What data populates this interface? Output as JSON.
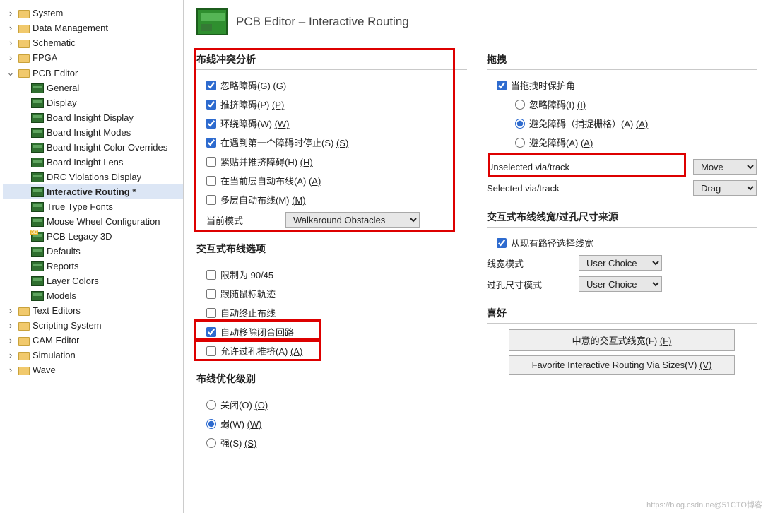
{
  "tree": [
    {
      "exp": ">",
      "i": "folder",
      "label": "System",
      "d": 0
    },
    {
      "exp": ">",
      "i": "folder",
      "label": "Data Management",
      "d": 0
    },
    {
      "exp": ">",
      "i": "folder",
      "label": "Schematic",
      "d": 0
    },
    {
      "exp": ">",
      "i": "folder",
      "label": "FPGA",
      "d": 0
    },
    {
      "exp": "v",
      "i": "folder",
      "label": "PCB Editor",
      "d": 0
    },
    {
      "exp": "",
      "i": "pcb",
      "label": "General",
      "d": 1
    },
    {
      "exp": "",
      "i": "pcb",
      "label": "Display",
      "d": 1
    },
    {
      "exp": "",
      "i": "pcb",
      "label": "Board Insight Display",
      "d": 1
    },
    {
      "exp": "",
      "i": "pcb",
      "label": "Board Insight Modes",
      "d": 1
    },
    {
      "exp": "",
      "i": "pcb",
      "label": "Board Insight Color Overrides",
      "d": 1
    },
    {
      "exp": "",
      "i": "pcb",
      "label": "Board Insight Lens",
      "d": 1
    },
    {
      "exp": "",
      "i": "pcb",
      "label": "DRC Violations Display",
      "d": 1
    },
    {
      "exp": "",
      "i": "pcb",
      "label": "Interactive Routing *",
      "d": 1,
      "sel": true
    },
    {
      "exp": "",
      "i": "pcb",
      "label": "True Type Fonts",
      "d": 1
    },
    {
      "exp": "",
      "i": "pcb",
      "label": "Mouse Wheel Configuration",
      "d": 1
    },
    {
      "exp": "",
      "i": "pcb3d",
      "label": "PCB Legacy 3D",
      "d": 1
    },
    {
      "exp": "",
      "i": "pcb",
      "label": "Defaults",
      "d": 1
    },
    {
      "exp": "",
      "i": "pcb",
      "label": "Reports",
      "d": 1
    },
    {
      "exp": "",
      "i": "pcb",
      "label": "Layer Colors",
      "d": 1
    },
    {
      "exp": "",
      "i": "pcb",
      "label": "Models",
      "d": 1
    },
    {
      "exp": ">",
      "i": "folder",
      "label": "Text Editors",
      "d": 0
    },
    {
      "exp": ">",
      "i": "folder",
      "label": "Scripting System",
      "d": 0
    },
    {
      "exp": ">",
      "i": "folder",
      "label": "CAM Editor",
      "d": 0
    },
    {
      "exp": ">",
      "i": "folder",
      "label": "Simulation",
      "d": 0
    },
    {
      "exp": ">",
      "i": "folder",
      "label": "Wave",
      "d": 0
    }
  ],
  "page_title": "PCB Editor – Interactive Routing",
  "sections": {
    "conflict": "布线冲突分析",
    "interactive": "交互式布线选项",
    "optimize": "布线优化级别",
    "drag": "拖拽",
    "width_src": "交互式布线线宽/过孔尺寸来源",
    "fav": "喜好"
  },
  "conflict": {
    "ignore": {
      "label": "忽略障碍(G)",
      "hot": "(G)",
      "checked": true
    },
    "push": {
      "label": "推挤障碍(P)",
      "hot": "(P)",
      "checked": true
    },
    "around": {
      "label": "环绕障碍(W)",
      "hot": "(W)",
      "checked": true
    },
    "stopfirst": {
      "label": "在遇到第一个障碍时停止(S)",
      "hot": "(S)",
      "checked": true
    },
    "hug": {
      "label": "紧贴并推挤障碍(H)",
      "hot": "(H)",
      "checked": false
    },
    "autocurrent": {
      "label": "在当前层自动布线(A)",
      "hot": "(A)",
      "checked": false
    },
    "multilayer": {
      "label": "多层自动布线(M)",
      "hot": "(M)",
      "checked": false
    },
    "mode_label": "当前模式",
    "mode_value": "Walkaround Obstacles"
  },
  "interactive": {
    "limit9045": {
      "label": "限制为 90/45",
      "checked": false
    },
    "followmouse": {
      "label": "跟随鼠标轨迹",
      "checked": false
    },
    "autoterm": {
      "label": "自动终止布线",
      "checked": false
    },
    "autoloopremove": {
      "label": "自动移除闭合回路",
      "checked": true
    },
    "allowviapush": {
      "label": "允许过孔推挤(A)",
      "hot": "(A)",
      "checked": false
    }
  },
  "optimize": {
    "off": {
      "label": "关闭(O)",
      "hot": "(O)",
      "sel": false
    },
    "weak": {
      "label": "弱(W)",
      "hot": "(W)",
      "sel": true
    },
    "strong": {
      "label": "强(S)",
      "hot": "(S)",
      "sel": false
    }
  },
  "drag": {
    "preserve": {
      "label": "当拖拽时保护角",
      "checked": true
    },
    "r_ignore": {
      "label": "忽略障碍(I)",
      "hot": "(I)",
      "sel": false
    },
    "r_avoid_snap": {
      "label": "避免障碍（捕捉栅格）(A)",
      "hot": "(A)",
      "sel": true
    },
    "r_avoid": {
      "label": "避免障碍(A)",
      "hot": "(A)",
      "sel": false
    },
    "unsel_label": "Unselected via/track",
    "unsel_value": "Move",
    "sel_label": "Selected via/track",
    "sel_value": "Drag"
  },
  "width_src": {
    "existing": {
      "label": "从现有路径选择线宽",
      "checked": true
    },
    "width_mode_label": "线宽模式",
    "width_mode_value": "User Choice",
    "via_mode_label": "过孔尺寸模式",
    "via_mode_value": "User Choice"
  },
  "fav": {
    "btn1": "中意的交互式线宽(F)",
    "btn1_hot": "(F)",
    "btn2": "Favorite Interactive Routing Via Sizes(V)",
    "btn2_hot": "(V)"
  },
  "watermark": "https://blog.csdn.ne@51CTO博客"
}
